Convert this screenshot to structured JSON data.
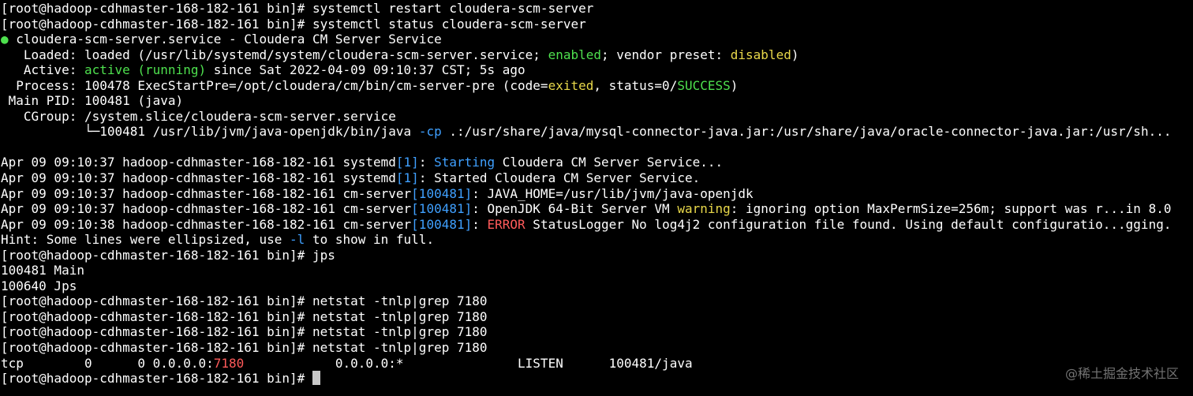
{
  "colors": {
    "background": "#000000",
    "text": "#ffffff",
    "green": "#4ee04e",
    "yellow": "#e8d84a",
    "blue": "#3fa0ff",
    "red": "#ff5a5a"
  },
  "terminal": {
    "lines": [
      {
        "segments": [
          {
            "text": "[root@hadoop-cdhmaster-168-182-161 bin]# systemctl restart cloudera-scm-server",
            "color": "white"
          }
        ]
      },
      {
        "segments": [
          {
            "text": "[root@hadoop-cdhmaster-168-182-161 bin]# systemctl status cloudera-scm-server",
            "color": "white"
          }
        ]
      },
      {
        "segments": [
          {
            "text": "●",
            "color": "green"
          },
          {
            "text": " cloudera-scm-server.service - Cloudera CM Server Service",
            "color": "white"
          }
        ]
      },
      {
        "segments": [
          {
            "text": "   Loaded: loaded (/usr/lib/systemd/system/cloudera-scm-server.service; ",
            "color": "white"
          },
          {
            "text": "enabled",
            "color": "green"
          },
          {
            "text": "; vendor preset: ",
            "color": "white"
          },
          {
            "text": "disabled",
            "color": "yellow"
          },
          {
            "text": ")",
            "color": "white"
          }
        ]
      },
      {
        "segments": [
          {
            "text": "   Active: ",
            "color": "white"
          },
          {
            "text": "active (running)",
            "color": "green"
          },
          {
            "text": " since Sat 2022-04-09 09:10:37 CST; 5s ago",
            "color": "white"
          }
        ]
      },
      {
        "segments": [
          {
            "text": "  Process: 100478 ExecStartPre=/opt/cloudera/cm/bin/cm-server-pre (code=",
            "color": "white"
          },
          {
            "text": "exited",
            "color": "yellow"
          },
          {
            "text": ", status=0/",
            "color": "white"
          },
          {
            "text": "SUCCESS",
            "color": "green"
          },
          {
            "text": ")",
            "color": "white"
          }
        ]
      },
      {
        "segments": [
          {
            "text": " Main PID: 100481 (java)",
            "color": "white"
          }
        ]
      },
      {
        "segments": [
          {
            "text": "   CGroup: /system.slice/cloudera-scm-server.service",
            "color": "white"
          }
        ]
      },
      {
        "segments": [
          {
            "text": "           └─100481 /usr/lib/jvm/java-openjdk/bin/java ",
            "color": "white"
          },
          {
            "text": "-cp",
            "color": "blue"
          },
          {
            "text": " .:/usr/share/java/mysql-connector-java.jar:/usr/share/java/oracle-connector-java.jar:/usr/sh...",
            "color": "white"
          }
        ]
      },
      {
        "segments": [
          {
            "text": "",
            "color": "white"
          }
        ]
      },
      {
        "segments": [
          {
            "text": "Apr 09 09:10:37 hadoop-cdhmaster-168-182-161 systemd",
            "color": "white"
          },
          {
            "text": "[1]",
            "color": "blue"
          },
          {
            "text": ": ",
            "color": "white"
          },
          {
            "text": "Starting",
            "color": "blue"
          },
          {
            "text": " Cloudera CM Server Service...",
            "color": "white"
          }
        ]
      },
      {
        "segments": [
          {
            "text": "Apr 09 09:10:37 hadoop-cdhmaster-168-182-161 systemd",
            "color": "white"
          },
          {
            "text": "[1]",
            "color": "blue"
          },
          {
            "text": ": Started Cloudera CM Server Service.",
            "color": "white"
          }
        ]
      },
      {
        "segments": [
          {
            "text": "Apr 09 09:10:37 hadoop-cdhmaster-168-182-161 cm-server",
            "color": "white"
          },
          {
            "text": "[100481]",
            "color": "blue"
          },
          {
            "text": ": JAVA_HOME=/usr/lib/jvm/java-openjdk",
            "color": "white"
          }
        ]
      },
      {
        "segments": [
          {
            "text": "Apr 09 09:10:37 hadoop-cdhmaster-168-182-161 cm-server",
            "color": "white"
          },
          {
            "text": "[100481]",
            "color": "blue"
          },
          {
            "text": ": OpenJDK 64-Bit Server VM ",
            "color": "white"
          },
          {
            "text": "warning",
            "color": "yellow"
          },
          {
            "text": ": ignoring option MaxPermSize=256m; support was r...in 8.0",
            "color": "white"
          }
        ]
      },
      {
        "segments": [
          {
            "text": "Apr 09 09:10:38 hadoop-cdhmaster-168-182-161 cm-server",
            "color": "white"
          },
          {
            "text": "[100481]",
            "color": "blue"
          },
          {
            "text": ": ",
            "color": "white"
          },
          {
            "text": "ERROR",
            "color": "red"
          },
          {
            "text": " StatusLogger No log4j2 configuration file found. Using default configuratio...gging.",
            "color": "white"
          }
        ]
      },
      {
        "segments": [
          {
            "text": "Hint: Some lines were ellipsized, use ",
            "color": "white"
          },
          {
            "text": "-l",
            "color": "blue"
          },
          {
            "text": " to show in full.",
            "color": "white"
          }
        ]
      },
      {
        "segments": [
          {
            "text": "[root@hadoop-cdhmaster-168-182-161 bin]# jps",
            "color": "white"
          }
        ]
      },
      {
        "segments": [
          {
            "text": "100481 Main",
            "color": "white"
          }
        ]
      },
      {
        "segments": [
          {
            "text": "100640 Jps",
            "color": "white"
          }
        ]
      },
      {
        "segments": [
          {
            "text": "[root@hadoop-cdhmaster-168-182-161 bin]# netstat -tnlp|grep 7180",
            "color": "white"
          }
        ]
      },
      {
        "segments": [
          {
            "text": "[root@hadoop-cdhmaster-168-182-161 bin]# netstat -tnlp|grep 7180",
            "color": "white"
          }
        ]
      },
      {
        "segments": [
          {
            "text": "[root@hadoop-cdhmaster-168-182-161 bin]# netstat -tnlp|grep 7180",
            "color": "white"
          }
        ]
      },
      {
        "segments": [
          {
            "text": "[root@hadoop-cdhmaster-168-182-161 bin]# netstat -tnlp|grep 7180",
            "color": "white"
          }
        ]
      },
      {
        "segments": [
          {
            "text": "tcp        0      0 0.0.0.0:",
            "color": "white"
          },
          {
            "text": "7180",
            "color": "red"
          },
          {
            "text": "            0.0.0.0:*               LISTEN      100481/java",
            "color": "white"
          }
        ]
      },
      {
        "segments": [
          {
            "text": "[root@hadoop-cdhmaster-168-182-161 bin]# ",
            "color": "white"
          }
        ],
        "cursor": true
      }
    ]
  },
  "watermark": {
    "text": "@稀土掘金技术社区"
  }
}
